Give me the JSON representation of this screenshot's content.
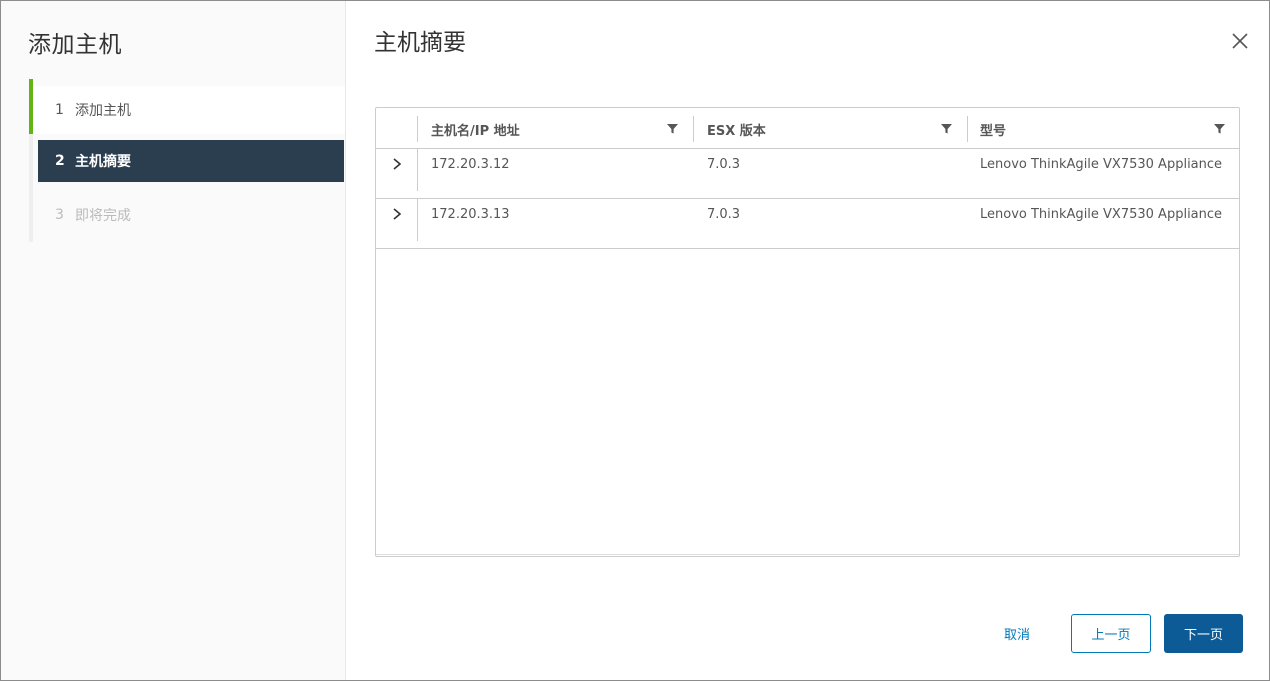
{
  "wizard": {
    "title": "添加主机",
    "steps": [
      {
        "num": "1",
        "label": "添加主机"
      },
      {
        "num": "2",
        "label": "主机摘要"
      },
      {
        "num": "3",
        "label": "即将完成"
      }
    ]
  },
  "page": {
    "title": "主机摘要"
  },
  "grid": {
    "columns": [
      "主机名/IP 地址",
      "ESX 版本",
      "型号"
    ],
    "rows": [
      {
        "host": "172.20.3.12",
        "version": "7.0.3",
        "model": "Lenovo ThinkAgile VX7530 Appliance"
      },
      {
        "host": "172.20.3.13",
        "version": "7.0.3",
        "model": "Lenovo ThinkAgile VX7530 Appliance"
      }
    ]
  },
  "buttons": {
    "cancel": "取消",
    "prev": "上一页",
    "next": "下一页"
  },
  "colors": {
    "active_step_bg": "#2b3e50",
    "completed_step_bar": "#60b515",
    "primary": "#0d5b96",
    "link": "#0079b8"
  },
  "icons": {
    "close": "close-icon",
    "filter": "filter-icon",
    "expand": "chevron-right-icon"
  }
}
